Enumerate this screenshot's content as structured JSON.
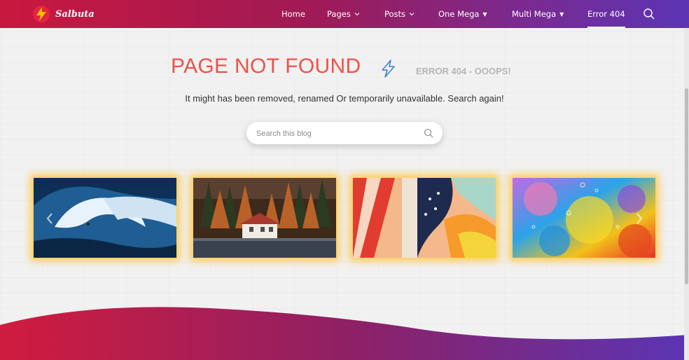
{
  "brand": {
    "name": "Salbuta",
    "icon": "lightning-logo-icon",
    "logo_color": "#f5c400"
  },
  "nav": {
    "items": [
      {
        "label": "Home"
      },
      {
        "label": "Pages"
      },
      {
        "label": "Posts"
      },
      {
        "label": "One Mega"
      },
      {
        "label": "Multi Mega"
      },
      {
        "label": "Error 404"
      }
    ],
    "active": "Error 404",
    "search_icon": "search-icon"
  },
  "error": {
    "title": "PAGE NOT FOUND",
    "subtitle": "ERROR 404 - OOOPS!",
    "description": "It might has been removed, renamed Or temporarily unavailable. Search again!",
    "icon": "lightning-bolt-icon"
  },
  "search": {
    "placeholder": "Search this blog"
  },
  "carousel": {
    "items": [
      {
        "image": "ocean-wave-surfer"
      },
      {
        "image": "autumn-forest-house"
      },
      {
        "image": "abstract-colorful-painting"
      },
      {
        "image": "colorful-oil-bubbles"
      }
    ]
  },
  "colors": {
    "accent_red": "#f0514a",
    "nav_gradient_start": "#c8183f",
    "nav_gradient_end": "#5b34b5",
    "card_glow": "#ffc43c",
    "subtitle_gray": "#b5b5b5"
  }
}
